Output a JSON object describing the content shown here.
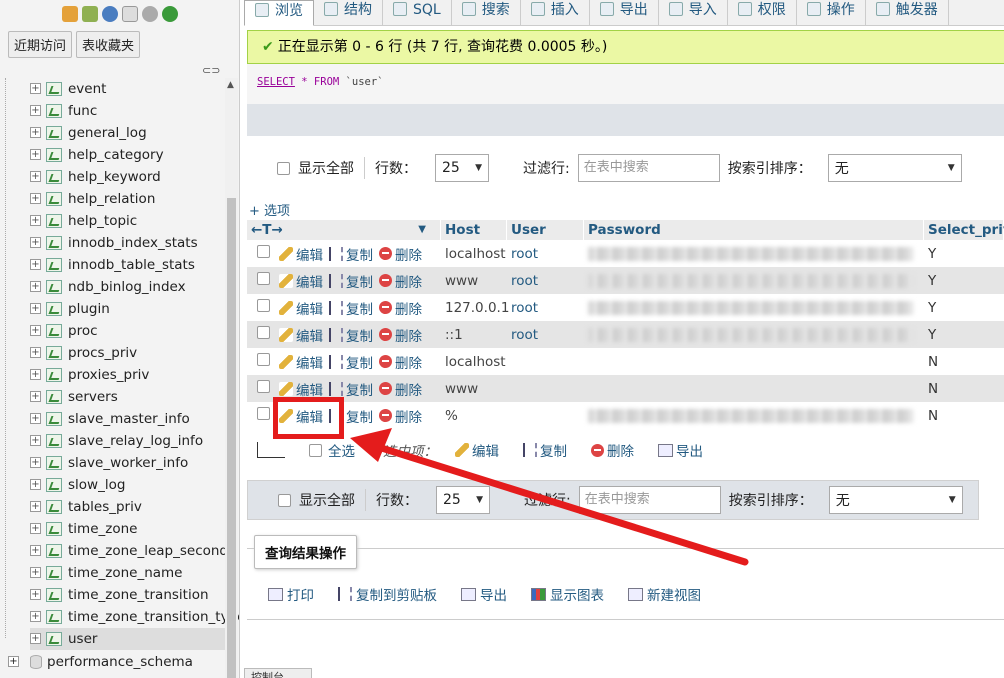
{
  "nav": {
    "recent_tab": "近期访问",
    "fav_tab": "表收藏夹",
    "tables": [
      "event",
      "func",
      "general_log",
      "help_category",
      "help_keyword",
      "help_relation",
      "help_topic",
      "innodb_index_stats",
      "innodb_table_stats",
      "ndb_binlog_index",
      "plugin",
      "proc",
      "procs_priv",
      "proxies_priv",
      "servers",
      "slave_master_info",
      "slave_relay_log_info",
      "slave_worker_info",
      "slow_log",
      "tables_priv",
      "time_zone",
      "time_zone_leap_second",
      "time_zone_name",
      "time_zone_transition",
      "time_zone_transition_type",
      "user"
    ],
    "active_table": "user",
    "other_db": "performance_schema"
  },
  "tabs": [
    "浏览",
    "结构",
    "SQL",
    "搜索",
    "插入",
    "导出",
    "导入",
    "权限",
    "操作",
    "触发器"
  ],
  "active_tab": "浏览",
  "success_message": "正在显示第 0 - 6 行 (共 7 行, 查询花费 0.0005 秒。)",
  "sql": {
    "select": "SELECT",
    "star": "*",
    "from": "FROM",
    "table": "`user`"
  },
  "controls": {
    "show_all": "显示全部",
    "rows_label": "行数：",
    "rows_value": "25",
    "filter_label": "过滤行:",
    "filter_placeholder": "在表中搜索",
    "sort_label": "按索引排序：",
    "sort_value": "无"
  },
  "options_link": "+ 选项",
  "columns": [
    "Host",
    "User",
    "Password",
    "Select_priv"
  ],
  "row_actions": {
    "edit": "编辑",
    "copy": "复制",
    "delete": "删除"
  },
  "rows": [
    {
      "host": "localhost",
      "user": "root",
      "password_hidden": true,
      "select_priv": "Y"
    },
    {
      "host": "www",
      "user": "root",
      "password_hidden": true,
      "select_priv": "Y"
    },
    {
      "host": "127.0.0.1",
      "user": "root",
      "password_hidden": true,
      "select_priv": "Y"
    },
    {
      "host": "::1",
      "user": "root",
      "password_hidden": true,
      "select_priv": "Y"
    },
    {
      "host": "localhost",
      "user": "",
      "password_hidden": false,
      "select_priv": "N"
    },
    {
      "host": "www",
      "user": "",
      "password_hidden": false,
      "select_priv": "N"
    },
    {
      "host": "%",
      "user": "",
      "password_hidden": true,
      "select_priv": "N"
    }
  ],
  "bulk": {
    "check_all": "全选",
    "selected_label": "选中项：",
    "edit": "编辑",
    "copy": "复制",
    "delete": "删除",
    "export": "导出"
  },
  "query_ops": {
    "legend": "查询结果操作",
    "print": "打印",
    "copy_clipboard": "复制到剪贴板",
    "export": "导出",
    "chart": "显示图表",
    "create_view": "新建视图"
  },
  "bottom_tab": "控制台",
  "colors": {
    "annotation": "#e41c1c",
    "success_bg": "#ebf8a4",
    "link": "#235a81"
  }
}
